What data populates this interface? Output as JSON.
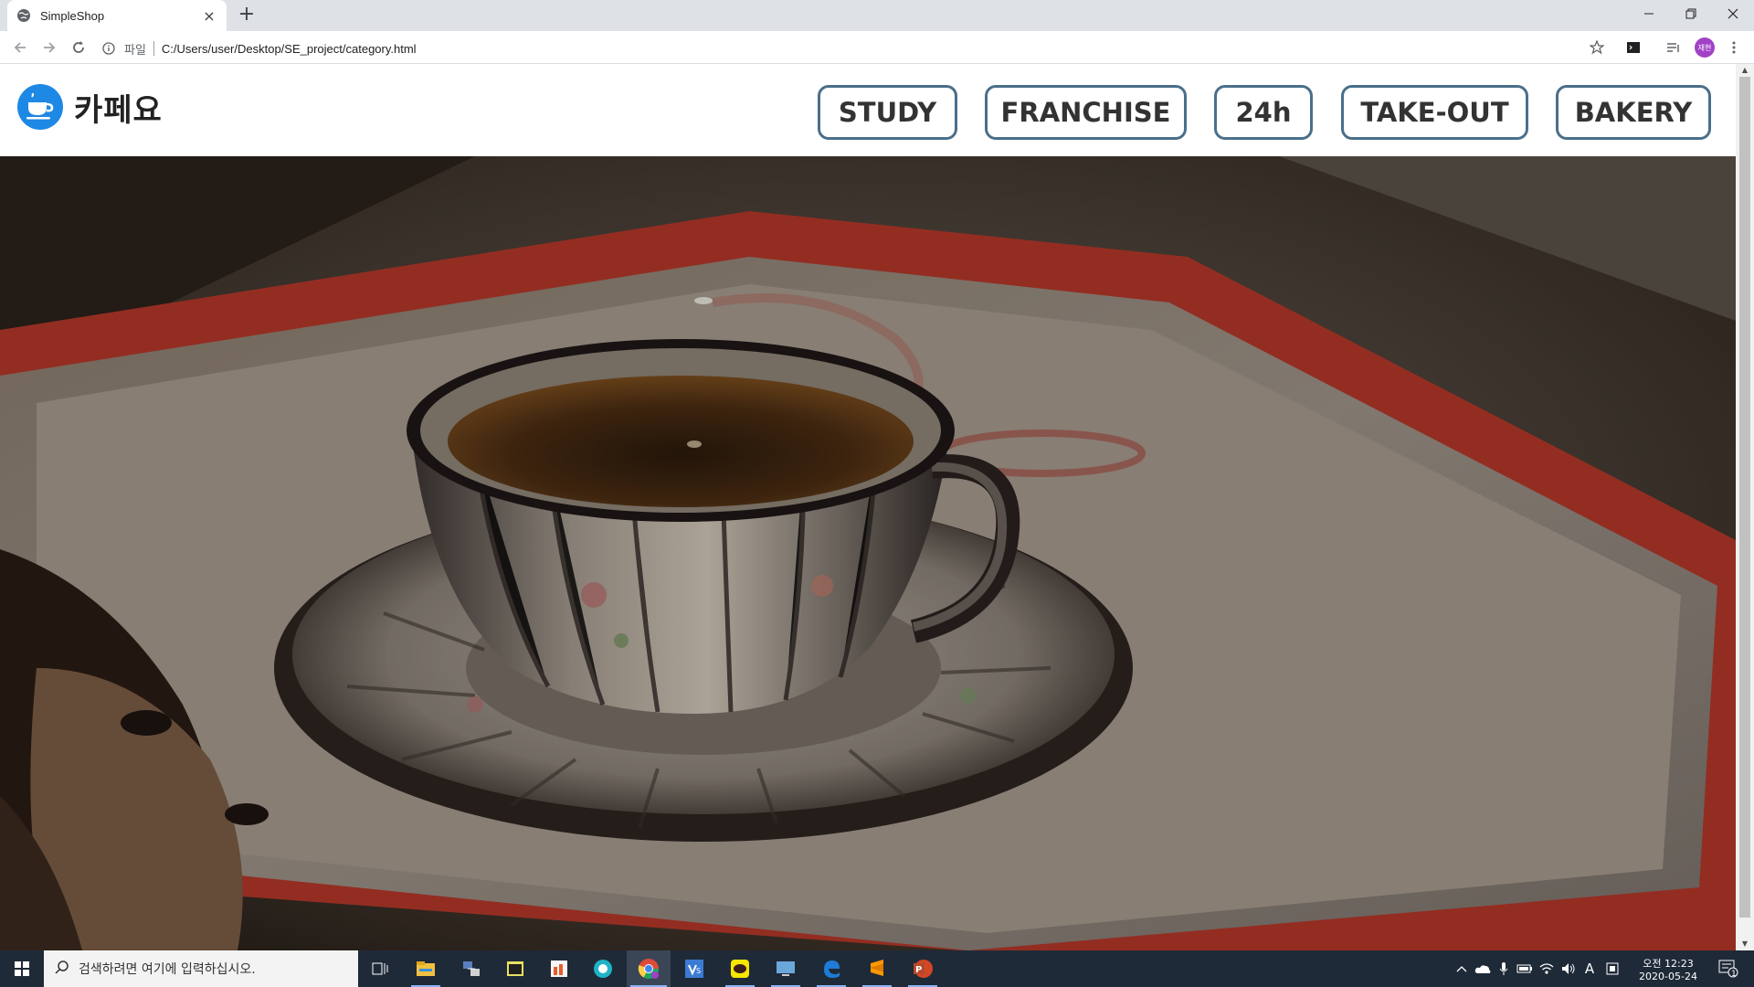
{
  "browser": {
    "tab_title": "SimpleShop",
    "tab_close": "×",
    "new_tab": "+",
    "scheme_label": "파일",
    "url": "C:/Users/user/Desktop/SE_project/category.html",
    "profile_initials": "재현"
  },
  "site": {
    "logo_text": "카페요",
    "nav": [
      {
        "label": "STUDY"
      },
      {
        "label": "FRANCHISE"
      },
      {
        "label": "24h"
      },
      {
        "label": "TAKE-OUT"
      },
      {
        "label": "BAKERY"
      }
    ],
    "hero_image": "coffee-cup-on-red-tray"
  },
  "taskbar": {
    "search_placeholder": "검색하려면 여기에 입력하십시오.",
    "apps": [
      "task-view",
      "file-explorer",
      "network-app",
      "notepad-app",
      "office-app",
      "photo-app",
      "chrome",
      "visual-studio",
      "kakaotalk",
      "remote-desktop",
      "edge",
      "sublime-text",
      "powerpoint"
    ],
    "time_ampm": "오전 12:23",
    "date": "2020-05-24",
    "notification_count": "1",
    "ime_label": "A"
  }
}
